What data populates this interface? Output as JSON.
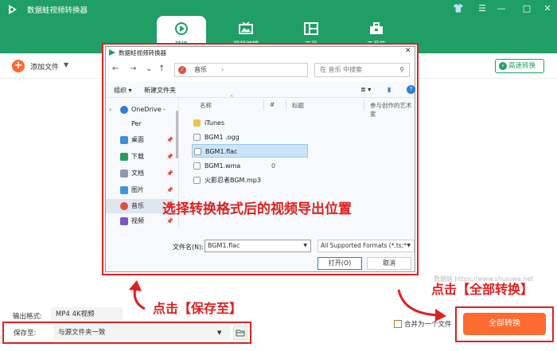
{
  "app": {
    "title": "数据蛙视频转换器"
  },
  "window_controls": {
    "shirt": "👕",
    "menu": "☰",
    "minimize": "—",
    "maximize": "□",
    "close": "✕"
  },
  "nav_tabs": [
    {
      "label": "转换",
      "icon": "convert-icon",
      "active": true
    },
    {
      "label": "视频编辑",
      "icon": "tv-icon"
    },
    {
      "label": "工具",
      "icon": "layout-icon"
    },
    {
      "label": "工具箱",
      "icon": "toolbox-icon"
    }
  ],
  "toolbar": {
    "add_symbol": "+",
    "add_label": "添加文件",
    "caret": "▼",
    "speed_label": "高速转换",
    "speed_symbol": "⚡"
  },
  "watermark": "数据蛙 https://www.shujuwa.net",
  "footer": {
    "output_label": "输出格式:",
    "output_value": "MP4 4K视频",
    "save_label": "保存至:",
    "save_value": "与源文件夹一致",
    "save_caret": "▼",
    "merge_label": "合并为一个文件",
    "convert_label": "全部转换"
  },
  "dialog": {
    "title": "数据蛙视频转换器",
    "close": "✕",
    "back": "←",
    "forward": "→",
    "up_caret": "⌄",
    "up": "↑",
    "address": "音乐",
    "address_icon": "♪",
    "address_chevron": "›",
    "address_caret": "⌄",
    "refresh": "↻",
    "search_placeholder": "在 音乐 中搜索",
    "search_icon": "⚲",
    "organize": "组织 ▾",
    "new_folder": "新建文件夹",
    "view_icon": "≣ ▾",
    "preview_icon": "▮",
    "help_icon": "?",
    "nav_items": [
      {
        "label": "OneDrive - Per",
        "icon": "cloud-icon",
        "pin": "",
        "chevron": "›"
      },
      {
        "label": "桌面",
        "icon": "desktop-icon",
        "pin": "📌"
      },
      {
        "label": "下载",
        "icon": "download-icon",
        "pin": "📌"
      },
      {
        "label": "文档",
        "icon": "document-icon",
        "pin": "📌"
      },
      {
        "label": "图片",
        "icon": "picture-icon",
        "pin": "📌"
      },
      {
        "label": "音乐",
        "icon": "music-icon",
        "pin": "📌",
        "selected": true
      },
      {
        "label": "视频",
        "icon": "video-icon",
        "pin": "📌"
      }
    ],
    "columns": [
      "名称",
      "#",
      "标题",
      "参与创作的艺术家"
    ],
    "sort_arrow": "^",
    "files": [
      {
        "name": "iTunes",
        "icon": "folder-icon",
        "num": ""
      },
      {
        "name": "BGM1 .ogg",
        "icon": "audio-file-icon",
        "num": ""
      },
      {
        "name": "BGM1.flac",
        "icon": "audio-file-icon",
        "num": "",
        "selected": true
      },
      {
        "name": "BGM1.wma",
        "icon": "audio-file-icon",
        "num": "0"
      },
      {
        "name": "火影忍者BGM.mp3",
        "icon": "audio-file-icon",
        "num": ""
      }
    ],
    "filename_label": "文件名(N):",
    "filename_value": "BGM1.flac",
    "filetype_value": "All Supported Formats (*.ts;*",
    "open_label": "打开(O)",
    "cancel_label": "取消"
  },
  "annotations": {
    "overlay": "选择转换格式后的视频导出位置",
    "save_hint": "点击【保存至】",
    "convert_hint": "点击【全部转换】"
  },
  "colors": {
    "brand_green": "#1f9e65",
    "accent_orange": "#ff6a2e",
    "annotation_red": "#e02020"
  }
}
